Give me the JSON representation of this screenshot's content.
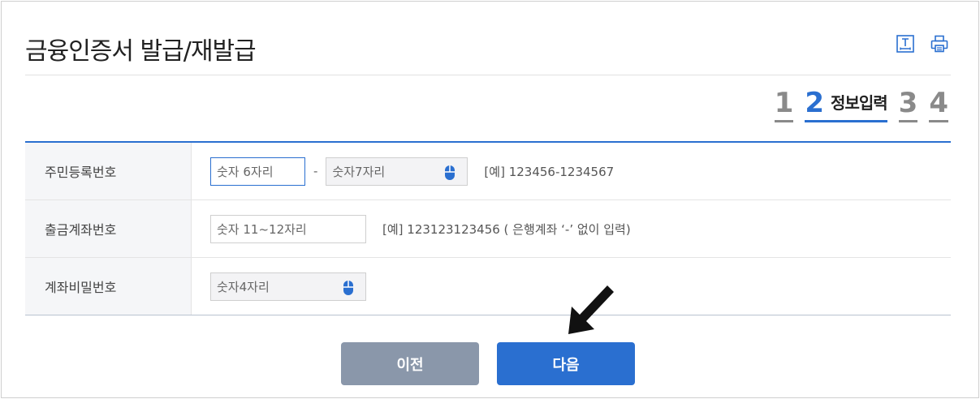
{
  "header": {
    "title": "금융인증서 발급/재발급",
    "tools": [
      "text-size-icon",
      "print-icon"
    ]
  },
  "steps": {
    "items": [
      {
        "num": "1",
        "label": "",
        "active": false
      },
      {
        "num": "2",
        "label": "정보입력",
        "active": true
      },
      {
        "num": "3",
        "label": "",
        "active": false
      },
      {
        "num": "4",
        "label": "",
        "active": false
      }
    ]
  },
  "form": {
    "resident": {
      "label": "주민등록번호",
      "front_placeholder": "숫자 6자리",
      "dash": "-",
      "back_placeholder": "숫자7자리",
      "hint": "[예] 123456-1234567"
    },
    "account": {
      "label": "출금계좌번호",
      "placeholder": "숫자 11~12자리",
      "hint": "[예] 123123123456 (       은행계좌 ‘-’ 없이 입력)"
    },
    "password": {
      "label": "계좌비밀번호",
      "placeholder": "숫자4자리"
    }
  },
  "buttons": {
    "prev": "이전",
    "next": "다음"
  },
  "colors": {
    "accent": "#2a6fd0",
    "prev_button": "#8a97aa",
    "label_bg": "#f5f6f8"
  },
  "icons": {
    "mouse": "mouse-icon",
    "pointer": "arrow-pointer-icon"
  }
}
